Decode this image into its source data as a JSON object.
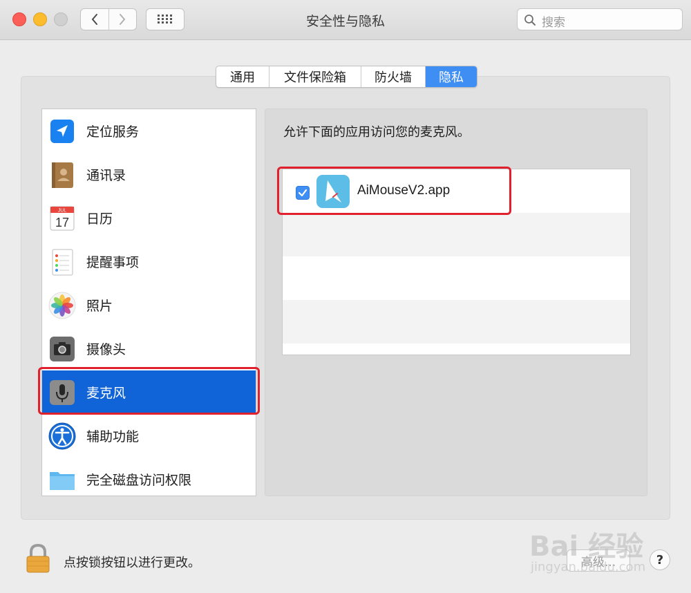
{
  "window": {
    "title": "安全性与隐私",
    "search_placeholder": "搜索"
  },
  "tabs": [
    {
      "label": "通用",
      "active": false
    },
    {
      "label": "文件保险箱",
      "active": false
    },
    {
      "label": "防火墙",
      "active": false
    },
    {
      "label": "隐私",
      "active": true
    }
  ],
  "sidebar": {
    "items": [
      {
        "label": "定位服务",
        "icon": "location-arrow-icon"
      },
      {
        "label": "通讯录",
        "icon": "contacts-book-icon"
      },
      {
        "label": "日历",
        "icon": "calendar-icon",
        "icon_month": "JUL",
        "icon_day": "17"
      },
      {
        "label": "提醒事项",
        "icon": "reminders-icon"
      },
      {
        "label": "照片",
        "icon": "photos-icon"
      },
      {
        "label": "摄像头",
        "icon": "camera-icon"
      },
      {
        "label": "麦克风",
        "icon": "microphone-icon",
        "selected": true
      },
      {
        "label": "辅助功能",
        "icon": "accessibility-icon"
      },
      {
        "label": "完全磁盘访问权限",
        "icon": "folder-icon"
      }
    ]
  },
  "main": {
    "description": "允许下面的应用访问您的麦克风。",
    "apps": [
      {
        "name": "AiMouseV2.app",
        "checked": true,
        "icon": "aimouse-app-icon"
      }
    ]
  },
  "footer": {
    "lock_text": "点按锁按钮以进行更改。",
    "advanced_label": "高级...",
    "help_label": "?"
  },
  "watermark": {
    "top": "Bai 经验",
    "bottom": "jingyan.baidu.com"
  },
  "colors": {
    "accent": "#3f8ef4",
    "selection": "#1163d8",
    "highlight": "#e0212d"
  }
}
